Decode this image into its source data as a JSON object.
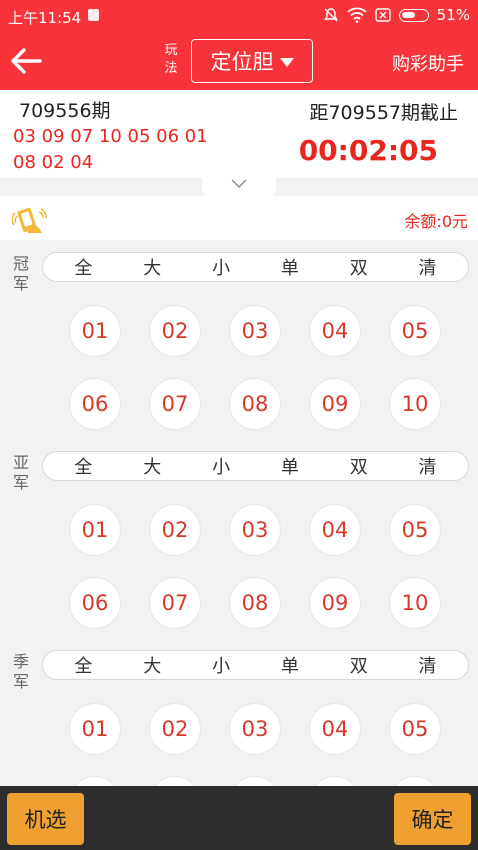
{
  "status": {
    "time": "上午11:54",
    "battery": "51%"
  },
  "header": {
    "back_icon": "back-arrow-icon",
    "play_label_1": "玩",
    "play_label_2": "法",
    "play_mode": "定位胆",
    "helper": "购彩助手"
  },
  "issue": {
    "last_period": "709556期",
    "last_numbers": "03 09 07 10 05 06 01 08 02 04",
    "next_label": "距709557期截止",
    "countdown": "00:02:05"
  },
  "balance": "余额:0元",
  "filters": [
    "全",
    "大",
    "小",
    "单",
    "双",
    "清"
  ],
  "sections": [
    {
      "label_1": "冠",
      "label_2": "军"
    },
    {
      "label_1": "亚",
      "label_2": "军"
    },
    {
      "label_1": "季",
      "label_2": "军"
    }
  ],
  "balls": [
    "01",
    "02",
    "03",
    "04",
    "05",
    "06",
    "07",
    "08",
    "09",
    "10"
  ],
  "footer": {
    "random": "机选",
    "confirm": "确定"
  },
  "colors": {
    "brand_red": "#f8333a",
    "number_red": "#e8261e",
    "button_orange": "#f0a030"
  }
}
